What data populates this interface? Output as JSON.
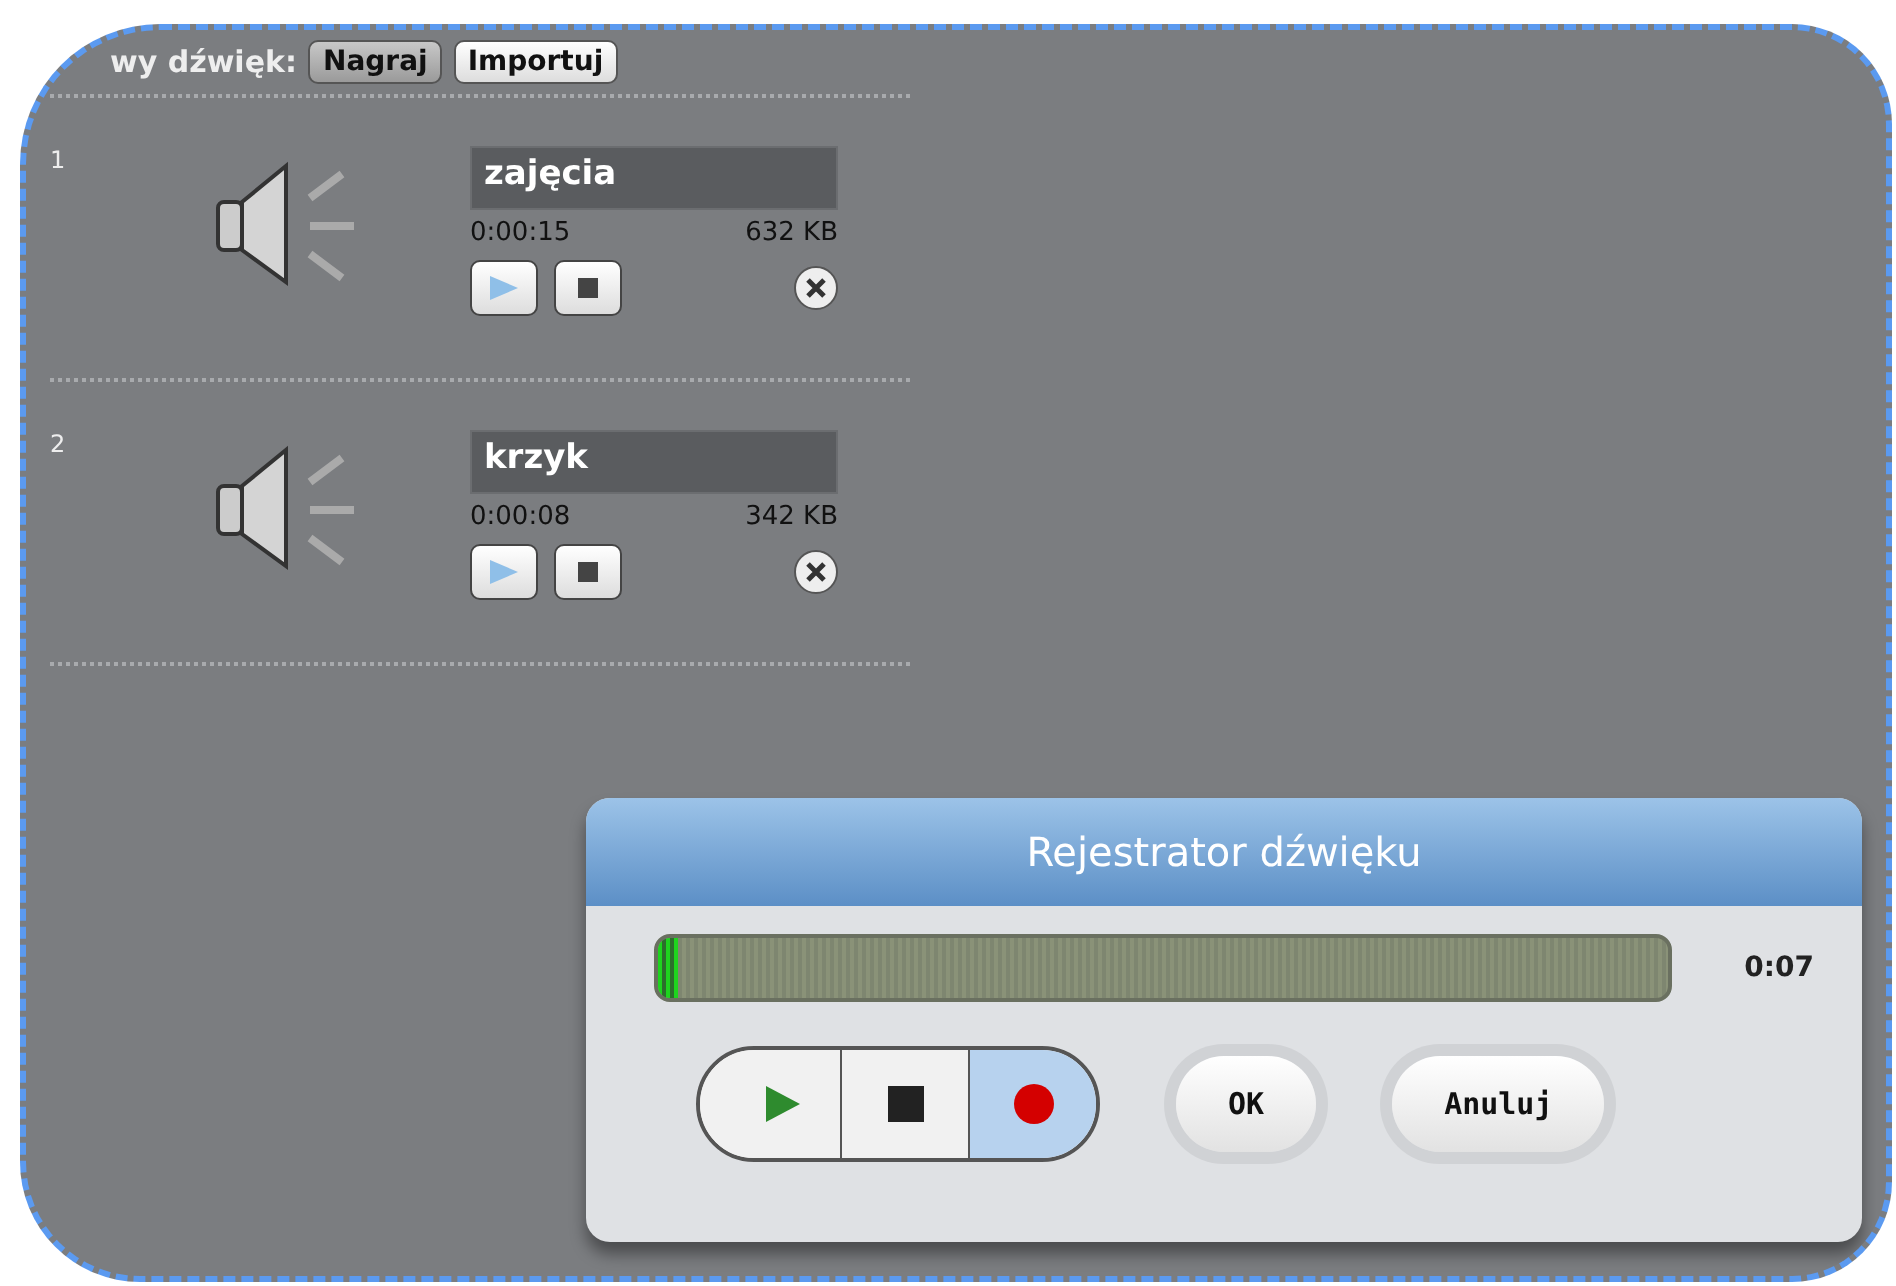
{
  "header": {
    "label": "wy dźwięk:",
    "buttons": [
      {
        "label": "Nagraj",
        "selected": true
      },
      {
        "label": "Importuj",
        "selected": false
      }
    ]
  },
  "sounds": [
    {
      "number": "1",
      "name": "zajęcia",
      "duration": "0:00:15",
      "size": "632 KB"
    },
    {
      "number": "2",
      "name": "krzyk",
      "duration": "0:00:08",
      "size": "342 KB"
    }
  ],
  "recorder": {
    "title": "Rejestrator dźwięku",
    "meter": {
      "level": 0.02
    },
    "time": "0:07",
    "transport": [
      {
        "kind": "play",
        "selected": false
      },
      {
        "kind": "stop",
        "selected": false
      },
      {
        "kind": "record",
        "selected": true
      }
    ],
    "buttons": [
      "OK",
      "Anuluj"
    ]
  }
}
